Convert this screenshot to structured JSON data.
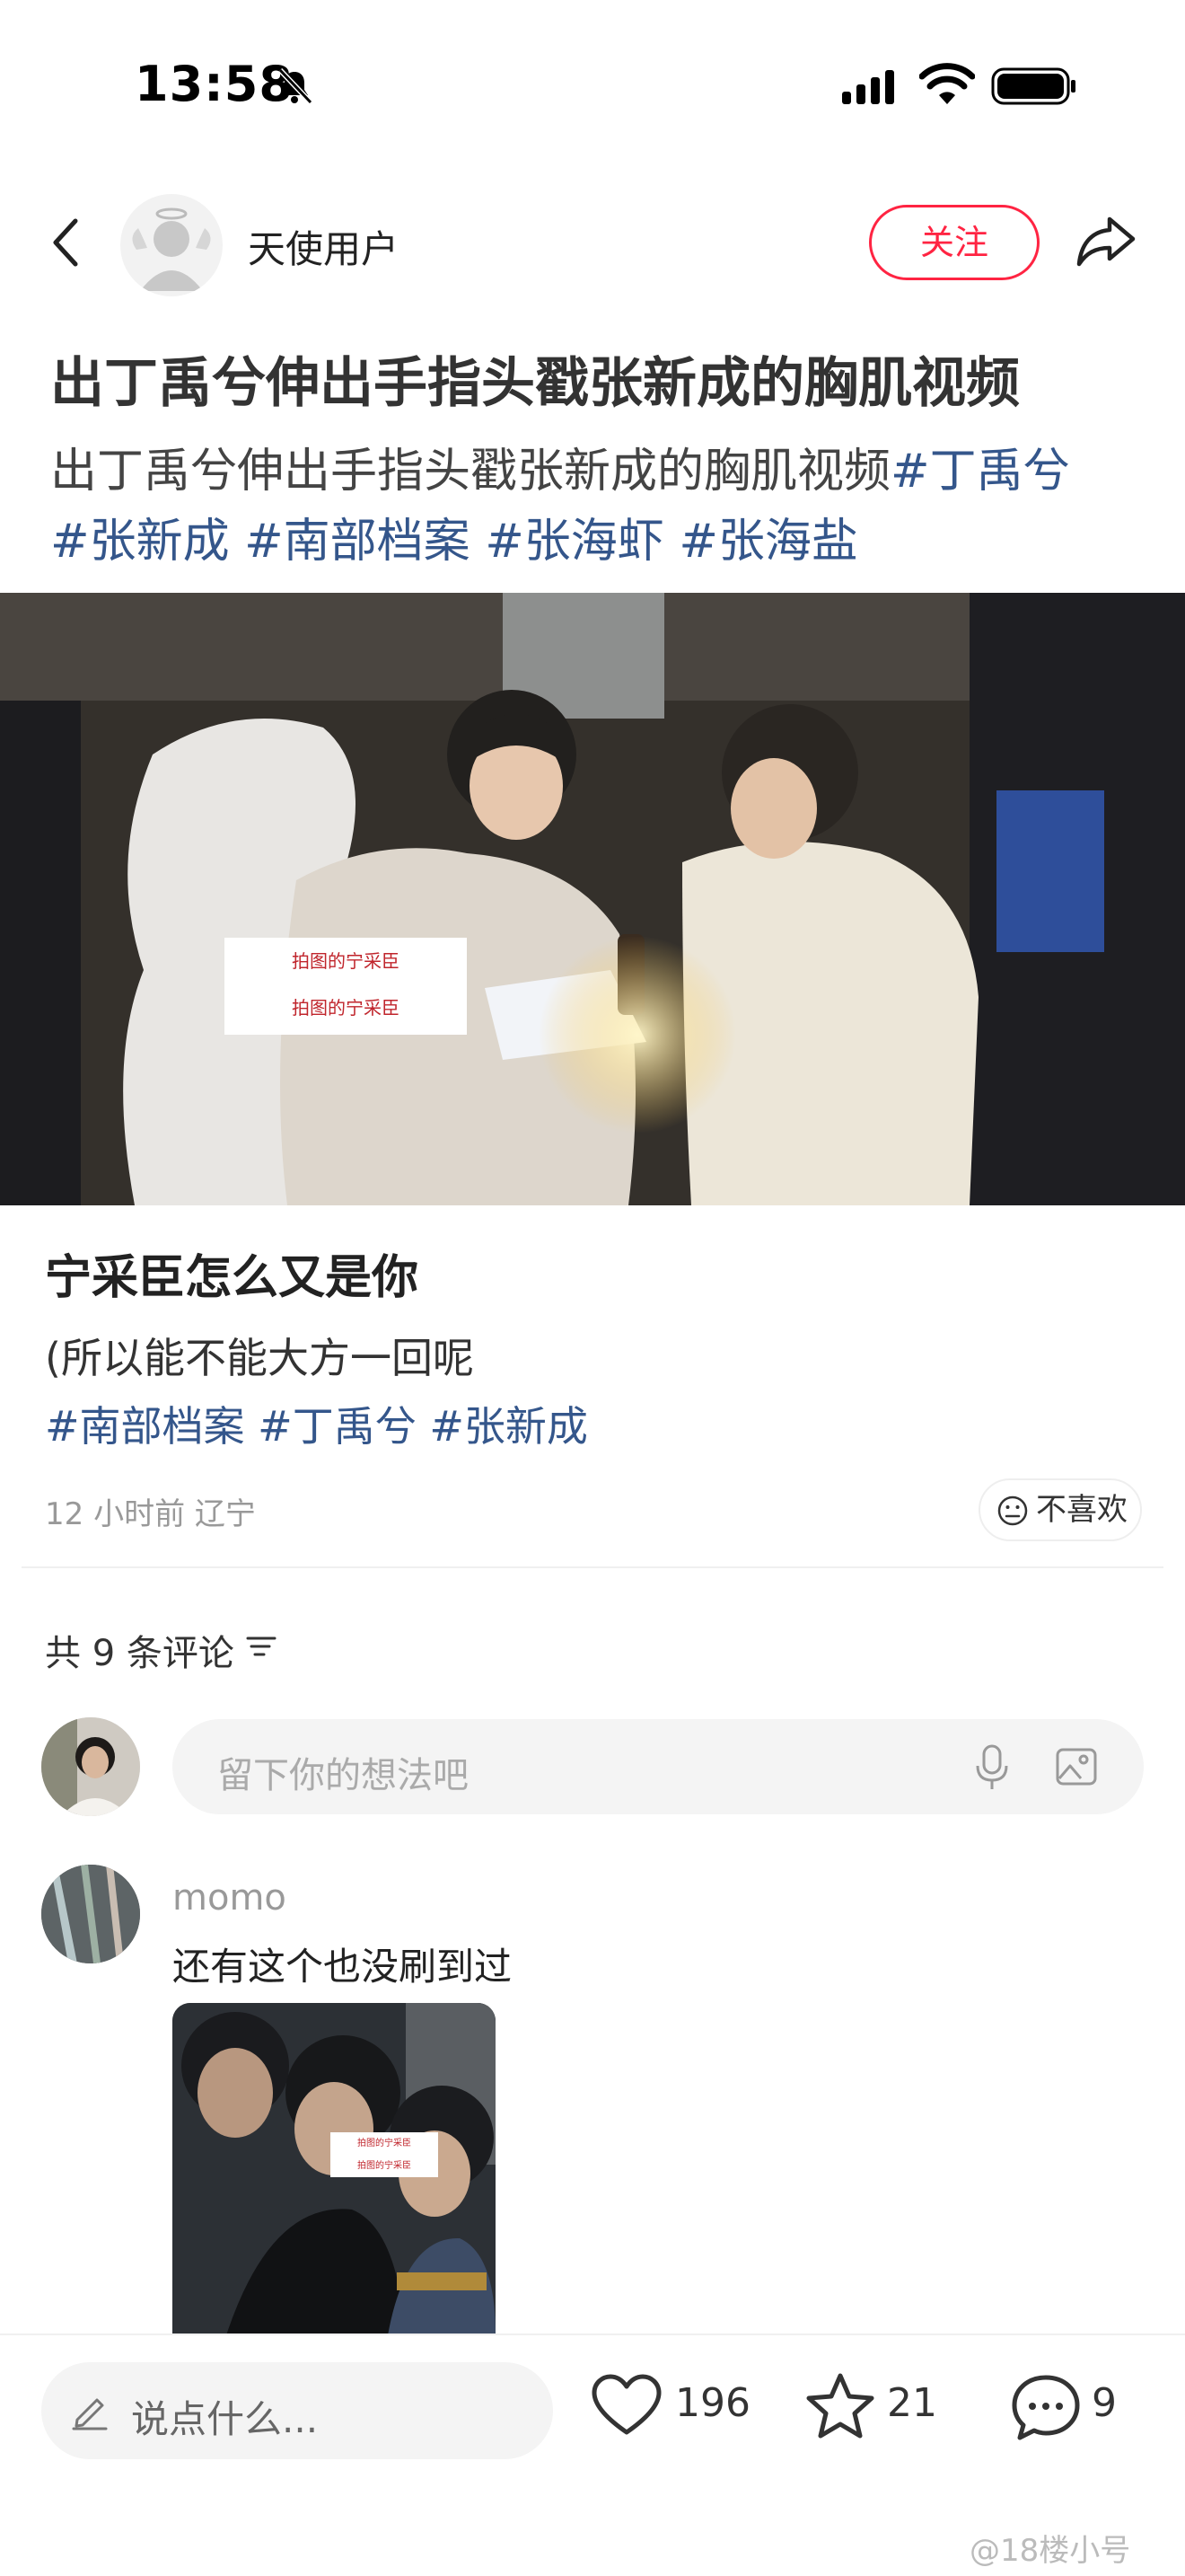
{
  "status_bar": {
    "time": "13:58"
  },
  "author": {
    "name": "天使用户",
    "follow_label": "关注"
  },
  "post": {
    "title": "出丁禹兮伸出手指头戳张新成的胸肌视频",
    "desc_text": "出丁禹兮伸出手指头戳张新成的胸肌视频",
    "desc_tags": [
      "#丁禹兮",
      "#张新成",
      "#南部档案",
      "#张海虾",
      "#张海盐"
    ],
    "image_watermark": [
      "拍图的宁采臣",
      "拍图的宁采臣"
    ]
  },
  "caption": {
    "title": "宁采臣怎么又是你",
    "body": "(所以能不能大方一回呢",
    "tags": "#南部档案 #丁禹兮 #张新成"
  },
  "meta": {
    "time_location": "12 小时前 辽宁",
    "dislike_label": "不喜欢"
  },
  "comments": {
    "count_label": "共 9 条评论",
    "input_placeholder": "留下你的想法吧",
    "items": [
      {
        "name": "momo",
        "text": "还有这个也没刷到过",
        "image_watermark": [
          "拍图的宁采臣",
          "拍图的宁采臣"
        ]
      }
    ]
  },
  "bottom": {
    "input_placeholder": "说点什么...",
    "likes": "196",
    "stars": "21",
    "comments": "9"
  },
  "watermark": "@18楼小号",
  "colors": {
    "accent": "#ff2442",
    "tag": "#34568b"
  }
}
